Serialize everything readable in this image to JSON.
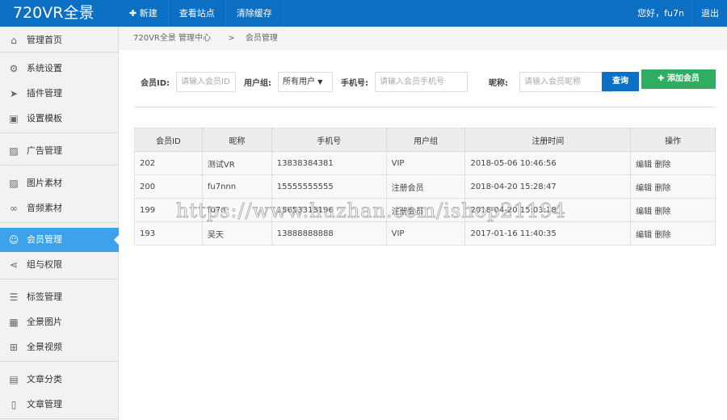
{
  "header": {
    "logo": "720VR全景",
    "nav": [
      {
        "label": "新建",
        "icon": "plus-icon"
      },
      {
        "label": "查看站点"
      },
      {
        "label": "清除缓存"
      }
    ],
    "greeting": "您好，fu7n",
    "logout": "退出"
  },
  "sidebar": {
    "items": [
      {
        "label": "管理首页",
        "icon": "home-icon",
        "glyph": "⌂"
      },
      {
        "label": "系统设置",
        "icon": "gear-icon",
        "glyph": "⚙"
      },
      {
        "label": "插件管理",
        "icon": "send-icon",
        "glyph": "➤"
      },
      {
        "label": "设置模板",
        "icon": "template-icon",
        "glyph": "▣"
      },
      {
        "label": "广告管理",
        "icon": "image-icon",
        "glyph": "▨"
      },
      {
        "label": "图片素材",
        "icon": "picture-icon",
        "glyph": "▨"
      },
      {
        "label": "音频素材",
        "icon": "link-icon",
        "glyph": "∞"
      },
      {
        "label": "会员管理",
        "icon": "users-icon",
        "glyph": "☺"
      },
      {
        "label": "组与权限",
        "icon": "share-icon",
        "glyph": "⋖"
      },
      {
        "label": "标签管理",
        "icon": "list-icon",
        "glyph": "☰"
      },
      {
        "label": "全景图片",
        "icon": "grid-icon",
        "glyph": "▦"
      },
      {
        "label": "全景视频",
        "icon": "apps-icon",
        "glyph": "⊞"
      },
      {
        "label": "文章分类",
        "icon": "book-icon",
        "glyph": "▤"
      },
      {
        "label": "文章管理",
        "icon": "file-icon",
        "glyph": "▯"
      }
    ]
  },
  "breadcrumb": {
    "root": "720VR全景 管理中心",
    "sep": ">",
    "current": "会员管理"
  },
  "filter": {
    "id_label": "会员ID:",
    "id_placeholder": "请输入会员ID",
    "group_label": "用户组:",
    "group_value": "所有用户",
    "phone_label": "手机号:",
    "phone_placeholder": "请输入会员手机号",
    "nick_label": "昵称:",
    "nick_placeholder": "请输入会员昵称",
    "search": "查询",
    "add": "添加会员"
  },
  "table": {
    "headers": [
      "会员ID",
      "昵称",
      "手机号",
      "用户组",
      "注册时间",
      "操作"
    ],
    "rows": [
      {
        "id": "202",
        "nick": "测试VR",
        "phone": "13838384381",
        "group": "VIP",
        "time": "2018-05-06 10:46:56"
      },
      {
        "id": "200",
        "nick": "fu7nnn",
        "phone": "15555555555",
        "group": "注册会员",
        "time": "2018-04-20 15:28:47"
      },
      {
        "id": "199",
        "nick": "fu7n",
        "phone": "15653313196",
        "group": "注册会员",
        "time": "2018-04-20 15:03:18"
      },
      {
        "id": "193",
        "nick": "吴天",
        "phone": "13888888888",
        "group": "VIP",
        "time": "2017-01-16 11:40:35"
      }
    ],
    "edit": "编辑",
    "delete": "删除"
  },
  "watermark": "https://www.huzhan.com/ishop21194"
}
